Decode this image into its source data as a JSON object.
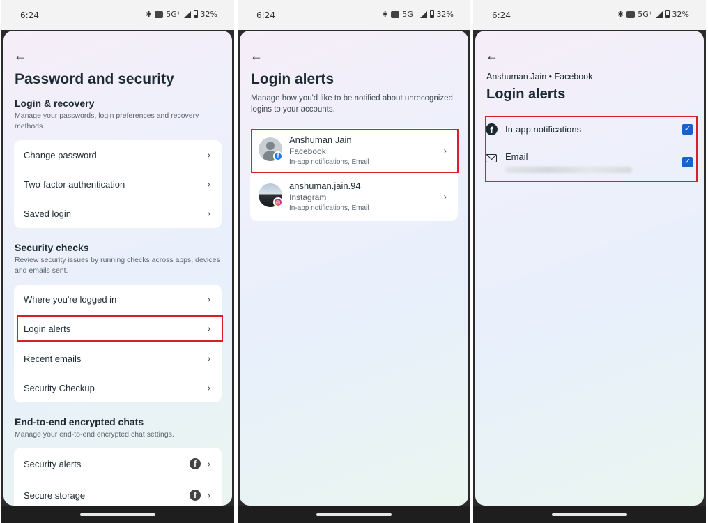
{
  "status_bar": {
    "time": "6:24",
    "network": "5G⁺",
    "battery": "32%"
  },
  "phone1": {
    "title": "Password and security",
    "login_recovery": {
      "heading": "Login & recovery",
      "description": "Manage your passwords, login preferences and recovery methods.",
      "items": [
        {
          "label": "Change password"
        },
        {
          "label": "Two-factor authentication"
        },
        {
          "label": "Saved login"
        }
      ]
    },
    "security_checks": {
      "heading": "Security checks",
      "description": "Review security issues by running checks across apps, devices and emails sent.",
      "items": [
        {
          "label": "Where you're logged in"
        },
        {
          "label": "Login alerts"
        },
        {
          "label": "Recent emails"
        },
        {
          "label": "Security Checkup"
        }
      ]
    },
    "e2ee": {
      "heading": "End-to-end encrypted chats",
      "description": "Manage your end-to-end encrypted chat settings.",
      "items": [
        {
          "label": "Security alerts"
        },
        {
          "label": "Secure storage"
        }
      ]
    }
  },
  "phone2": {
    "title": "Login alerts",
    "description": "Manage how you'd like to be notified about unrecognized logins to your accounts.",
    "accounts": [
      {
        "name": "Anshuman Jain",
        "app": "Facebook",
        "meta": "In-app notifications, Email",
        "badge": "f"
      },
      {
        "name": "anshuman.jain.94",
        "app": "Instagram",
        "meta": "In-app notifications, Email",
        "badge": "◎"
      }
    ]
  },
  "phone3": {
    "subtitle": "Anshuman Jain • Facebook",
    "title": "Login alerts",
    "options": [
      {
        "label": "In-app notifications",
        "icon": "facebook-icon",
        "checked": true
      },
      {
        "label": "Email",
        "icon": "mail-icon",
        "checked": true
      }
    ]
  },
  "colors": {
    "highlight": "#d8202c",
    "checkbox": "#1762cf",
    "facebook_blue": "#1877f2"
  },
  "glyphs": {
    "back": "←",
    "chevron": "›",
    "check": "✓",
    "fb": "f"
  }
}
